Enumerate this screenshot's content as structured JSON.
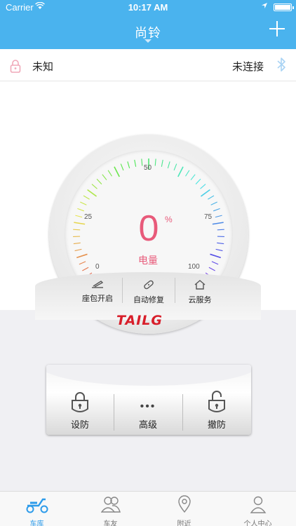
{
  "status_bar": {
    "carrier": "Carrier",
    "time": "10:17 AM"
  },
  "nav": {
    "title": "尚铃"
  },
  "info": {
    "lock_status": "未知",
    "connection_status": "未连接"
  },
  "gauge": {
    "value": "0",
    "unit": "%",
    "label": "电量",
    "scale": {
      "s0": "0",
      "s25": "25",
      "s50": "50",
      "s75": "75",
      "s100": "100"
    }
  },
  "actions": [
    {
      "label": "座包开启",
      "icon": "seat-icon"
    },
    {
      "label": "自动修复",
      "icon": "bandage-icon"
    },
    {
      "label": "云服务",
      "icon": "home-icon"
    }
  ],
  "brand": {
    "logo": "TAILG",
    "color": "#d81e2a"
  },
  "controls": [
    {
      "label": "设防",
      "icon": "lock-closed-icon"
    },
    {
      "label": "高级",
      "icon": "more-icon"
    },
    {
      "label": "撤防",
      "icon": "lock-open-icon"
    }
  ],
  "tabs": [
    {
      "label": "车库",
      "icon": "scooter-icon",
      "active": true
    },
    {
      "label": "车友",
      "icon": "friends-icon",
      "active": false
    },
    {
      "label": "附近",
      "icon": "location-icon",
      "active": false
    },
    {
      "label": "个人中心",
      "icon": "person-icon",
      "active": false
    }
  ],
  "colors": {
    "nav_bg": "#4ab3ee",
    "accent": "#e85a7a",
    "tab_active": "#2d9bea"
  }
}
